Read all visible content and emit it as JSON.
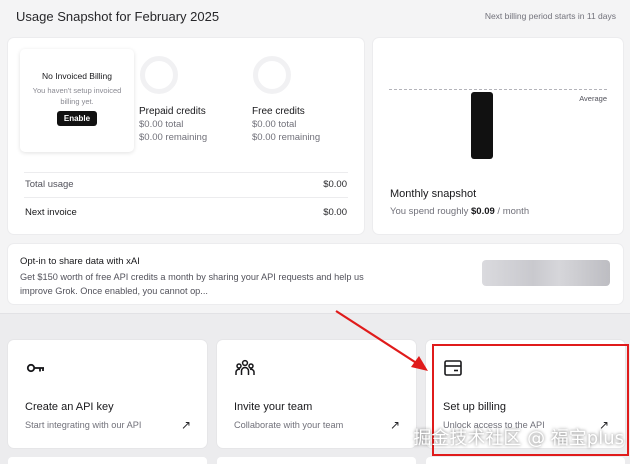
{
  "header": {
    "title": "Usage Snapshot for February 2025",
    "billing_note": "Next billing period starts in 11 days"
  },
  "invoice_box": {
    "title": "No Invoiced Billing",
    "subtitle": "You haven't setup invoiced billing yet.",
    "enable_label": "Enable"
  },
  "credits": {
    "prepaid": {
      "title": "Prepaid credits",
      "total": "$0.00 total",
      "remaining": "$0.00 remaining"
    },
    "free": {
      "title": "Free credits",
      "total": "$0.00 total",
      "remaining": "$0.00 remaining"
    }
  },
  "usage_rows": {
    "total_label": "Total usage",
    "total_value": "$0.00",
    "next_label": "Next invoice",
    "next_value": "$0.00"
  },
  "snapshot": {
    "average_label": "Average",
    "title": "Monthly snapshot",
    "sub_prefix": "You spend roughly",
    "sub_amount": "$0.09",
    "sub_suffix": "/ month",
    "bar_value_fraction": 0.95
  },
  "optin": {
    "title": "Opt-in to share data with xAI",
    "description": "Get $150 worth of free API credits a month by sharing your API requests and help us improve Grok. Once enabled, you cannot op..."
  },
  "actions": [
    {
      "title": "Create an API key",
      "subtitle": "Start integrating with our API",
      "icon": "key-icon"
    },
    {
      "title": "Invite your team",
      "subtitle": "Collaborate with your team",
      "icon": "team-icon"
    },
    {
      "title": "Set up billing",
      "subtitle": "Unlock access to the API",
      "icon": "billing-card-icon"
    }
  ],
  "watermark": "掘金技术社区 @ 福宝plus",
  "colors": {
    "highlight": "#e01b1b",
    "bar": "#111111",
    "accent_text": "#18181b"
  }
}
